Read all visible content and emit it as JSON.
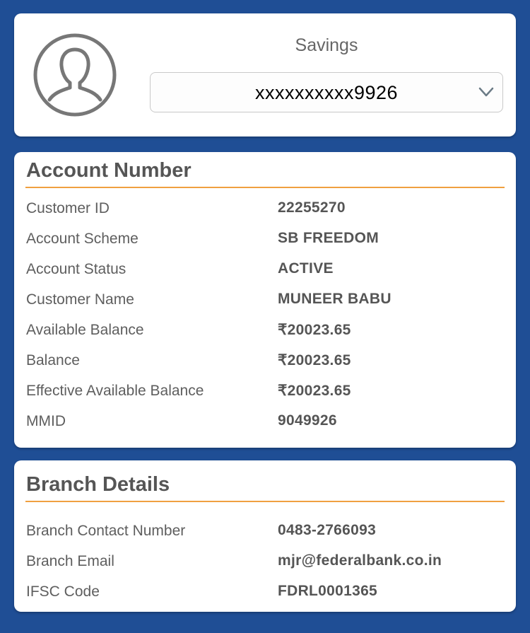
{
  "profile": {
    "account_type": "Savings",
    "selected_account": "xxxxxxxxxx9926"
  },
  "account_section": {
    "title": "Account Number",
    "rows": [
      {
        "label": "Customer ID",
        "value": "22255270"
      },
      {
        "label": "Account Scheme",
        "value": "SB FREEDOM"
      },
      {
        "label": "Account Status",
        "value": "ACTIVE"
      },
      {
        "label": "Customer Name",
        "value": "MUNEER BABU"
      },
      {
        "label": "Available Balance",
        "value": "₹20023.65"
      },
      {
        "label": "Balance",
        "value": "₹20023.65"
      },
      {
        "label": "Effective Available Balance",
        "value": "₹20023.65"
      },
      {
        "label": "MMID",
        "value": "9049926"
      }
    ]
  },
  "branch_section": {
    "title": "Branch Details",
    "rows": [
      {
        "label": "Branch Contact Number",
        "value": "0483-2766093"
      },
      {
        "label": "Branch Email",
        "value": "mjr@federalbank.co.in"
      },
      {
        "label": "IFSC Code",
        "value": "FDRL0001365"
      }
    ]
  },
  "colors": {
    "background": "#1f4e95",
    "accent_rule": "#f0a040"
  },
  "icons": {
    "avatar": "user-avatar-icon",
    "dropdown": "chevron-down-icon"
  }
}
